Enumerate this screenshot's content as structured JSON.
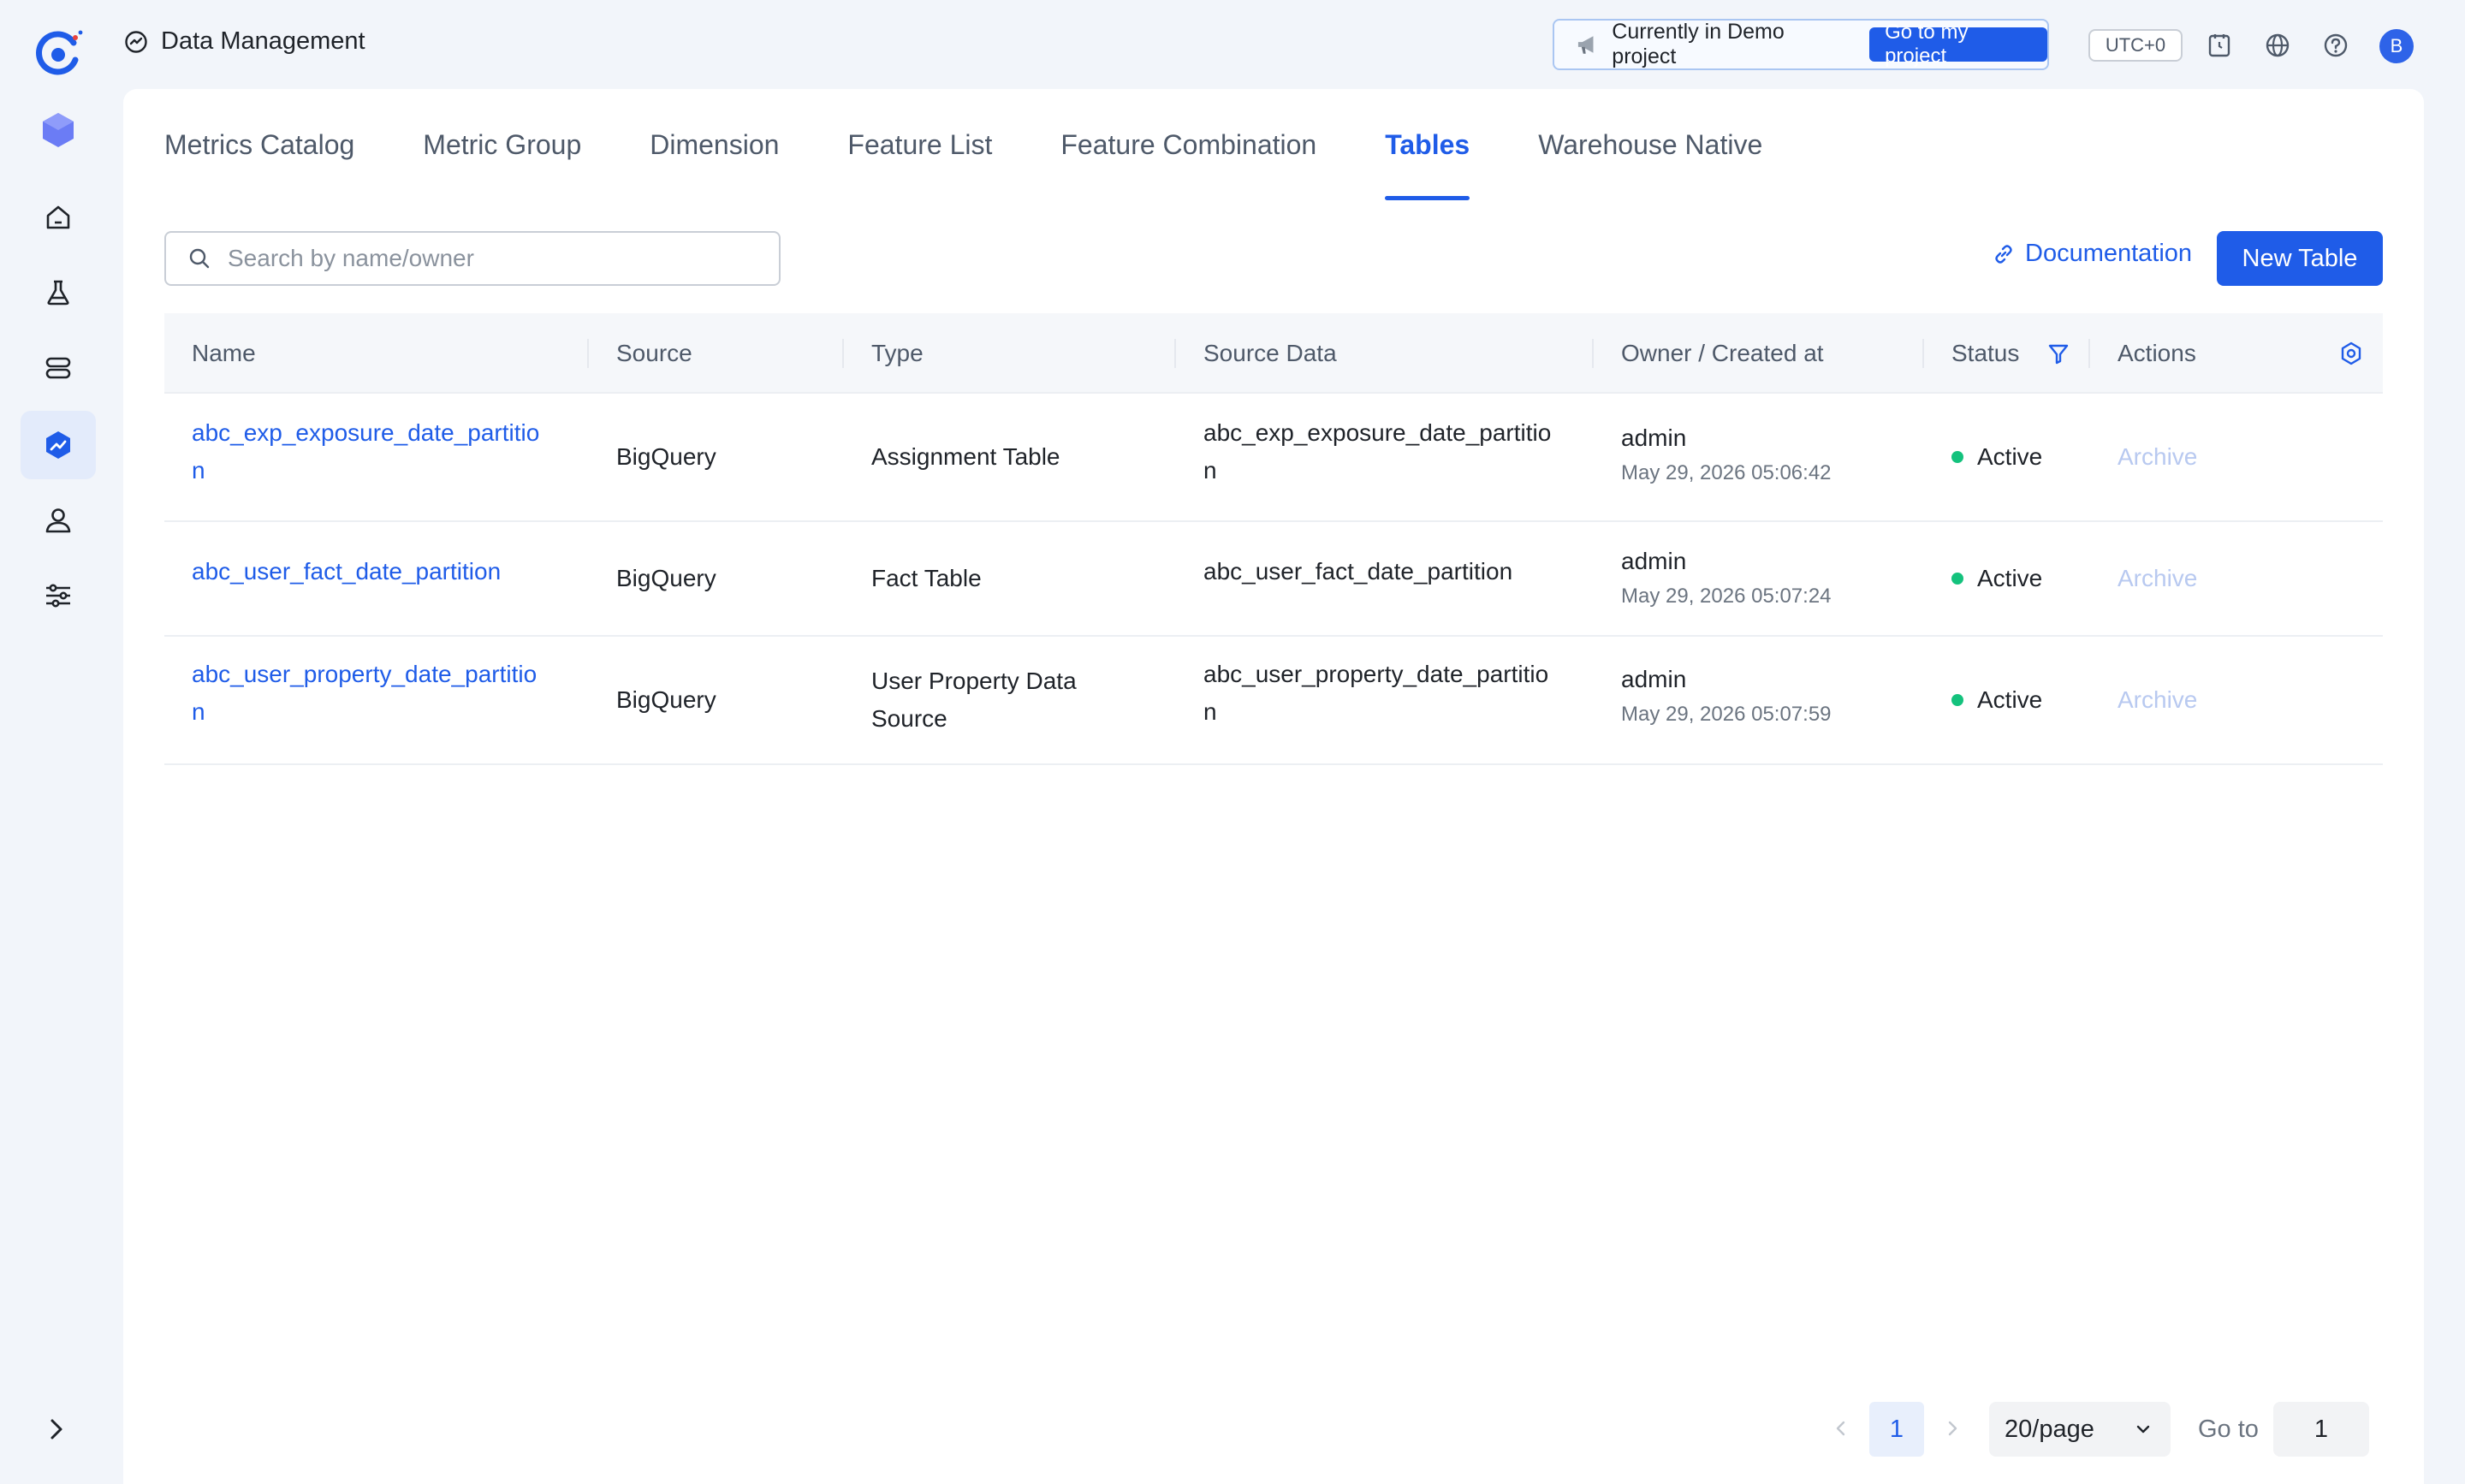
{
  "header": {
    "breadcrumb": "Data Management",
    "demo_text": "Currently in Demo project",
    "goto_button": "Go to my project",
    "timezone": "UTC+0",
    "avatar_initial": "B"
  },
  "tabs": [
    {
      "label": "Metrics Catalog",
      "active": false
    },
    {
      "label": "Metric Group",
      "active": false
    },
    {
      "label": "Dimension",
      "active": false
    },
    {
      "label": "Feature List",
      "active": false
    },
    {
      "label": "Feature Combination",
      "active": false
    },
    {
      "label": "Tables",
      "active": true
    },
    {
      "label": "Warehouse Native",
      "active": false
    }
  ],
  "toolbar": {
    "search_placeholder": "Search by name/owner",
    "documentation": "Documentation",
    "new_table": "New Table"
  },
  "table": {
    "columns": [
      "Name",
      "Source",
      "Type",
      "Source Data",
      "Owner / Created at",
      "Status",
      "Actions"
    ],
    "rows": [
      {
        "name_l1": "abc_exp_exposure_date_partitio",
        "name_l2": "n",
        "source": "BigQuery",
        "type_l1": "Assignment Table",
        "type_l2": "",
        "source_data_l1": "abc_exp_exposure_date_partitio",
        "source_data_l2": "n",
        "owner": "admin",
        "created_at": "May 29, 2026 05:06:42",
        "status": "Active",
        "action": "Archive"
      },
      {
        "name_l1": "abc_user_fact_date_partition",
        "name_l2": "",
        "source": "BigQuery",
        "type_l1": "Fact Table",
        "type_l2": "",
        "source_data_l1": "abc_user_fact_date_partition",
        "source_data_l2": "",
        "owner": "admin",
        "created_at": "May 29, 2026 05:07:24",
        "status": "Active",
        "action": "Archive"
      },
      {
        "name_l1": "abc_user_property_date_partitio",
        "name_l2": "n",
        "source": "BigQuery",
        "type_l1": "User Property Data",
        "type_l2": "Source",
        "source_data_l1": "abc_user_property_date_partitio",
        "source_data_l2": "n",
        "owner": "admin",
        "created_at": "May 29, 2026 05:07:59",
        "status": "Active",
        "action": "Archive"
      }
    ]
  },
  "pagination": {
    "current_page": "1",
    "page_size": "20/page",
    "goto_label": "Go to",
    "goto_value": "1"
  },
  "colors": {
    "primary": "#1f5ce8",
    "active_status": "#14c27d",
    "archive_disabled": "#b8c9f0"
  },
  "icons": {
    "sidebar": [
      "home-icon",
      "flask-icon",
      "database-icon",
      "data-management-icon",
      "user-icon",
      "settings-sliders-icon"
    ]
  }
}
